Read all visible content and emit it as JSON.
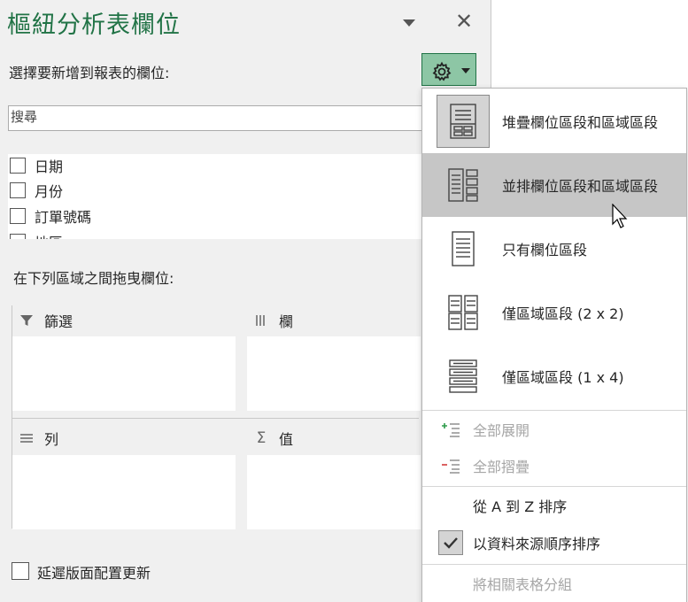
{
  "pane": {
    "title": "樞紐分析表欄位",
    "choose_fields_label": "選擇要新增到報表的欄位:",
    "search_placeholder": "搜尋",
    "fields": [
      {
        "label": "日期"
      },
      {
        "label": "月份"
      },
      {
        "label": "訂單號碼"
      },
      {
        "label": "地區"
      }
    ],
    "drag_label": "在下列區域之間拖曳欄位:",
    "areas": {
      "filters": "篩選",
      "columns": "欄",
      "rows": "列",
      "values": "值"
    },
    "defer_label": "延遲版面配置更新"
  },
  "menu": {
    "layout_options": [
      {
        "label": "堆疊欄位區段和區域區段",
        "selected": true
      },
      {
        "label": "並排欄位區段和區域區段",
        "hovered": true
      },
      {
        "label": "只有欄位區段"
      },
      {
        "label": "僅區域區段 (2 x 2)"
      },
      {
        "label": "僅區域區段 (1 x 4)"
      }
    ],
    "expand_all": "全部展開",
    "collapse_all": "全部摺疊",
    "sort_a_to_z": "從 A 到 Z 排序",
    "sort_data_source": "以資料來源順序排序",
    "group_related": "將相關表格分組"
  },
  "colors": {
    "title_green": "#217346",
    "gear_button_bg": "#8dc6a5",
    "hover_bg": "#c6c6c6"
  }
}
